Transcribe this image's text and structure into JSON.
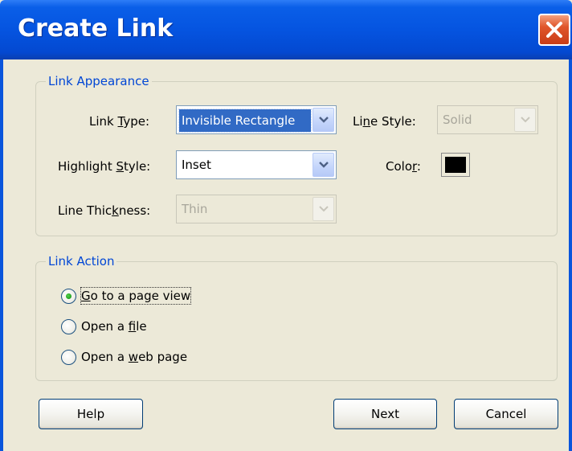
{
  "window": {
    "title": "Create Link"
  },
  "link_appearance": {
    "legend": "Link Appearance",
    "link_type": {
      "label_pre": "Link ",
      "label_ul": "T",
      "label_post": "ype:",
      "value": "Invisible Rectangle"
    },
    "line_style": {
      "label_pre": "Li",
      "label_ul": "n",
      "label_post": "e Style:",
      "value": "Solid"
    },
    "highlight_style": {
      "label_pre": "Highlight ",
      "label_ul": "S",
      "label_post": "tyle:",
      "value": "Inset"
    },
    "color": {
      "label_pre": "Colo",
      "label_ul": "r",
      "label_post": ":",
      "swatch": "#000000"
    },
    "line_thickness": {
      "label_pre": "Line Thic",
      "label_ul": "k",
      "label_post": "ness:",
      "value": "Thin"
    }
  },
  "link_action": {
    "legend": "Link Action",
    "options": [
      {
        "pre": "",
        "ul": "G",
        "post": "o to a page view",
        "selected": true
      },
      {
        "pre": "Open a ",
        "ul": "f",
        "post": "ile",
        "selected": false
      },
      {
        "pre": "Open a ",
        "ul": "w",
        "post": "eb page",
        "selected": false
      }
    ]
  },
  "buttons": {
    "help": "Help",
    "next": "Next",
    "cancel": "Cancel"
  },
  "colors": {
    "titlebar": "#0554e0",
    "legend_text": "#0046d5",
    "dialog_bg": "#ece9d8",
    "selection": "#316ac5"
  },
  "icons": {
    "close": "close-icon",
    "dropdown": "chevron-down-icon"
  }
}
